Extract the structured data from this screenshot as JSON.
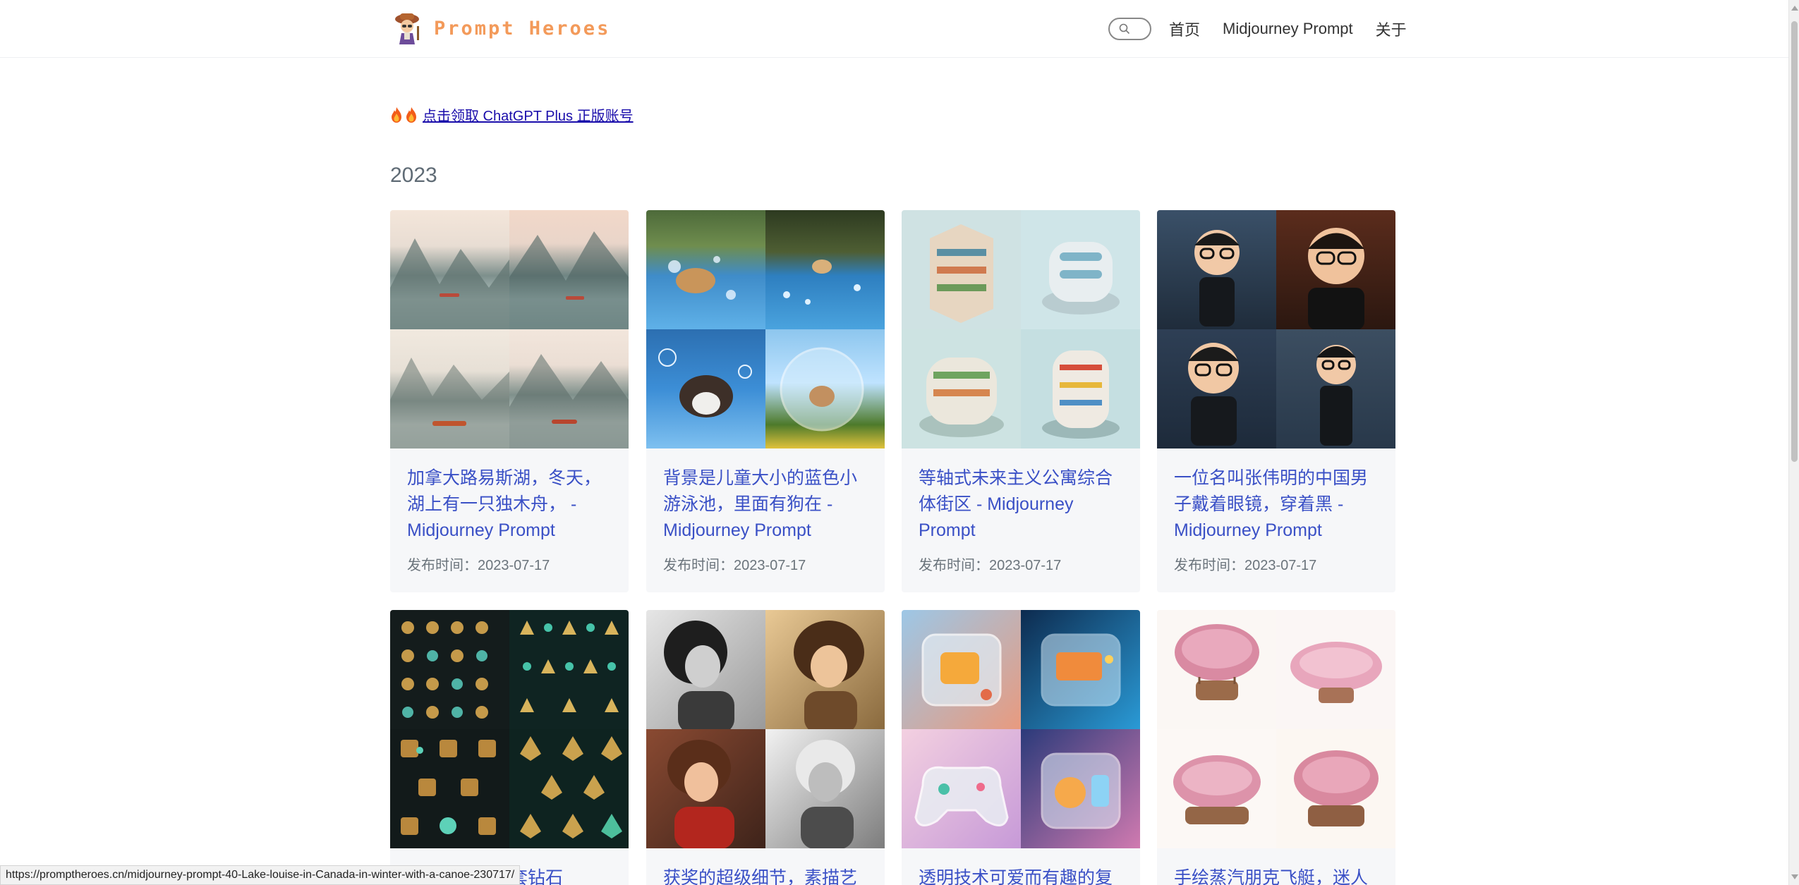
{
  "header": {
    "logo_text": "Prompt Heroes",
    "nav": [
      {
        "label": "首页"
      },
      {
        "label": "Midjourney Prompt"
      },
      {
        "label": "关于"
      }
    ]
  },
  "promo": {
    "emoji": "🔥🔥",
    "link_text": "点击领取 ChatGPT Plus 正版账号"
  },
  "section": {
    "year": "2023"
  },
  "posts": [
    {
      "title": "加拿大路易斯湖，冬天，湖上有一只独木舟， - Midjourney Prompt",
      "date": "发布时间：2023-07-17"
    },
    {
      "title": "背景是儿童大小的蓝色小游泳池，里面有狗在 - Midjourney Prompt",
      "date": "发布时间：2023-07-17"
    },
    {
      "title": "等轴式未来主义公寓综合体街区 - Midjourney Prompt",
      "date": "发布时间：2023-07-17"
    },
    {
      "title": "一位名叫张伟明的中国男子戴着眼镜，穿着黑 - Midjourney Prompt",
      "date": "发布时间：2023-07-17"
    },
    {
      "title": "表的一套钻石"
    },
    {
      "title": "获奖的超级细节，素描艺"
    },
    {
      "title": "透明技术可爱而有趣的复"
    },
    {
      "title": "手绘蒸汽朋克飞艇，迷人"
    }
  ],
  "status_bar": {
    "url": "https://promptheroes.cn/midjourney-prompt-40-Lake-louise-in-Canada-in-winter-with-a-canoe-230717/"
  },
  "colors": {
    "accent_link": "#3a50c6",
    "logo": "#f39a5a",
    "card_bg": "#f6f7f9"
  }
}
